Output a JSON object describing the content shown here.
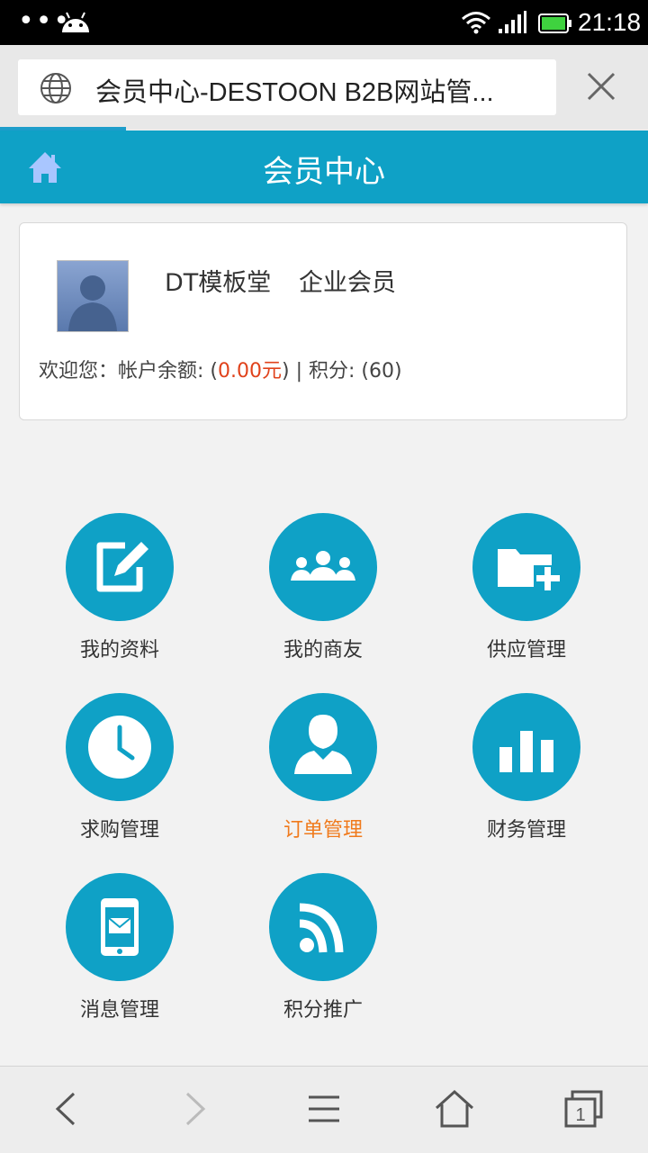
{
  "status_bar": {
    "dots": "•••",
    "time": "21:18",
    "icons": [
      "android-icon",
      "wifi-icon",
      "signal-icon",
      "battery-icon"
    ]
  },
  "browser": {
    "url_title": "会员中心-DESTOON B2B网站管..."
  },
  "header": {
    "title": "会员中心"
  },
  "user": {
    "name": "DT模板堂",
    "group": "企业会员",
    "welcome_prefix": "欢迎您：帐户余额: (",
    "balance": "0.00元",
    "welcome_suffix": ") | 积分: (60)"
  },
  "menu": [
    {
      "label": "我的资料",
      "icon": "edit-profile-icon"
    },
    {
      "label": "我的商友",
      "icon": "friends-icon"
    },
    {
      "label": "供应管理",
      "icon": "folder-add-icon"
    },
    {
      "label": "求购管理",
      "icon": "clock-icon"
    },
    {
      "label": "订单管理",
      "icon": "user-icon"
    },
    {
      "label": "财务管理",
      "icon": "bar-chart-icon"
    },
    {
      "label": "消息管理",
      "icon": "phone-message-icon"
    },
    {
      "label": "积分推广",
      "icon": "rss-icon"
    }
  ],
  "colors": {
    "accent": "#0fa1c6",
    "balance": "#e0421b",
    "active_label": "#f07a1c"
  },
  "bottom_nav": {
    "tab_count": "1",
    "icons": [
      "back-icon",
      "forward-icon",
      "menu-icon",
      "home-icon",
      "tabs-icon"
    ]
  }
}
